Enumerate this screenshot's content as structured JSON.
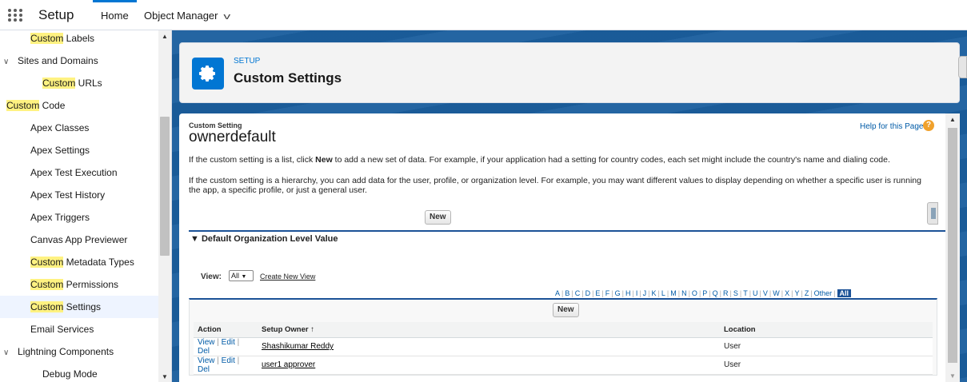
{
  "topbar": {
    "app_name": "Setup",
    "tabs": [
      {
        "label": "Home"
      },
      {
        "label": "Object Manager"
      }
    ]
  },
  "sidebar": {
    "items": [
      {
        "pre": "",
        "hl": "Custom",
        "post": " Labels"
      },
      {
        "pre": "Sites and Domains",
        "hl": "",
        "post": ""
      },
      {
        "pre": "",
        "hl": "Custom",
        "post": " URLs"
      },
      {
        "pre": "",
        "hl": "Custom",
        "post": " Code"
      },
      {
        "pre": "Apex Classes",
        "hl": "",
        "post": ""
      },
      {
        "pre": "Apex Settings",
        "hl": "",
        "post": ""
      },
      {
        "pre": "Apex Test Execution",
        "hl": "",
        "post": ""
      },
      {
        "pre": "Apex Test History",
        "hl": "",
        "post": ""
      },
      {
        "pre": "Apex Triggers",
        "hl": "",
        "post": ""
      },
      {
        "pre": "Canvas App Previewer",
        "hl": "",
        "post": ""
      },
      {
        "pre": "",
        "hl": "Custom",
        "post": " Metadata Types"
      },
      {
        "pre": "",
        "hl": "Custom",
        "post": " Permissions"
      },
      {
        "pre": "",
        "hl": "Custom",
        "post": " Settings"
      },
      {
        "pre": "Email Services",
        "hl": "",
        "post": ""
      },
      {
        "pre": "Lightning Components",
        "hl": "",
        "post": ""
      },
      {
        "pre": "Debug Mode",
        "hl": "",
        "post": ""
      }
    ]
  },
  "header": {
    "kicker": "SETUP",
    "title": "Custom Settings"
  },
  "content": {
    "kicker": "Custom Setting",
    "title": "ownerdefault",
    "help_link": "Help for this Page",
    "help_icon": "?",
    "para1_pre": "If the custom setting is a list, click ",
    "para1_bold": "New",
    "para1_post": " to add a new set of data. For example, if your application had a setting for country codes, each set might include the country's name and dialing code.",
    "para2": "If the custom setting is a hierarchy, you can add data for the user, profile, or organization level. For example, you may want different values to display depending on whether a specific user is running the app, a specific profile, or just a general user.",
    "new_button": "New",
    "section_title": "Default Organization Level Value"
  },
  "list_view": {
    "view_label": "View:",
    "view_selected": "All",
    "create_view": "Create New View",
    "alpha": [
      "A",
      "B",
      "C",
      "D",
      "E",
      "F",
      "G",
      "H",
      "I",
      "J",
      "K",
      "L",
      "M",
      "N",
      "O",
      "P",
      "Q",
      "R",
      "S",
      "T",
      "U",
      "V",
      "W",
      "X",
      "Y",
      "Z",
      "Other",
      "All"
    ],
    "alpha_active": "All",
    "new_button": "New",
    "columns": [
      "Action",
      "Setup Owner ↑",
      "Location"
    ],
    "action_links": [
      "View",
      "Edit",
      "Del"
    ],
    "rows": [
      {
        "owner": "Shashikumar Reddy",
        "location": "User"
      },
      {
        "owner": "user1 approver",
        "location": "User"
      }
    ]
  }
}
